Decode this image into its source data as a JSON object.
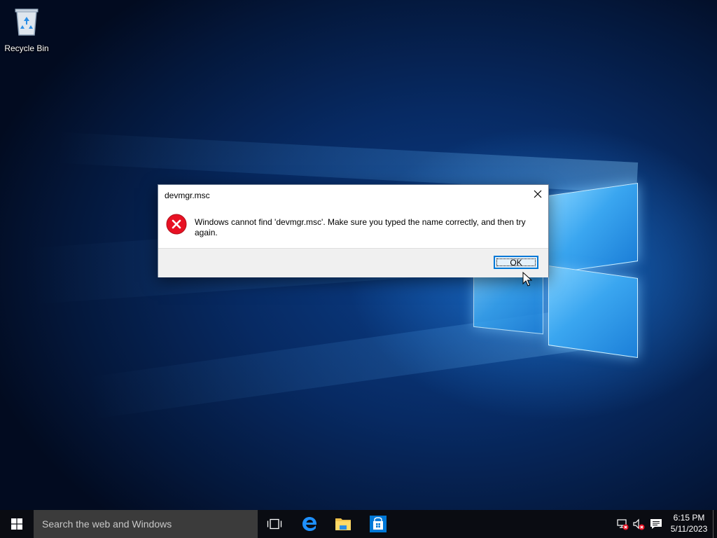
{
  "desktop": {
    "icons": [
      {
        "label": "Recycle Bin",
        "icon": "recycle-bin-icon"
      }
    ]
  },
  "dialog": {
    "title": "devmgr.msc",
    "message": "Windows cannot find 'devmgr.msc'. Make sure you typed the name correctly, and then try again.",
    "ok_label": "OK",
    "icon": "error-icon",
    "close_icon": "close-icon"
  },
  "taskbar": {
    "search_placeholder": "Search the web and Windows",
    "apps": [
      {
        "name": "task-view-icon"
      },
      {
        "name": "edge-icon"
      },
      {
        "name": "file-explorer-icon"
      },
      {
        "name": "store-icon"
      }
    ],
    "tray": {
      "network_icon": "network-disconnected-icon",
      "volume_icon": "volume-muted-icon",
      "notifications_icon": "action-center-icon"
    },
    "time": "6:15 PM",
    "date": "5/11/2023"
  },
  "colors": {
    "accent": "#0078d7",
    "error_red": "#e81123",
    "taskbar_bg": "#0a0c12",
    "search_bg": "#3b3b3b"
  }
}
